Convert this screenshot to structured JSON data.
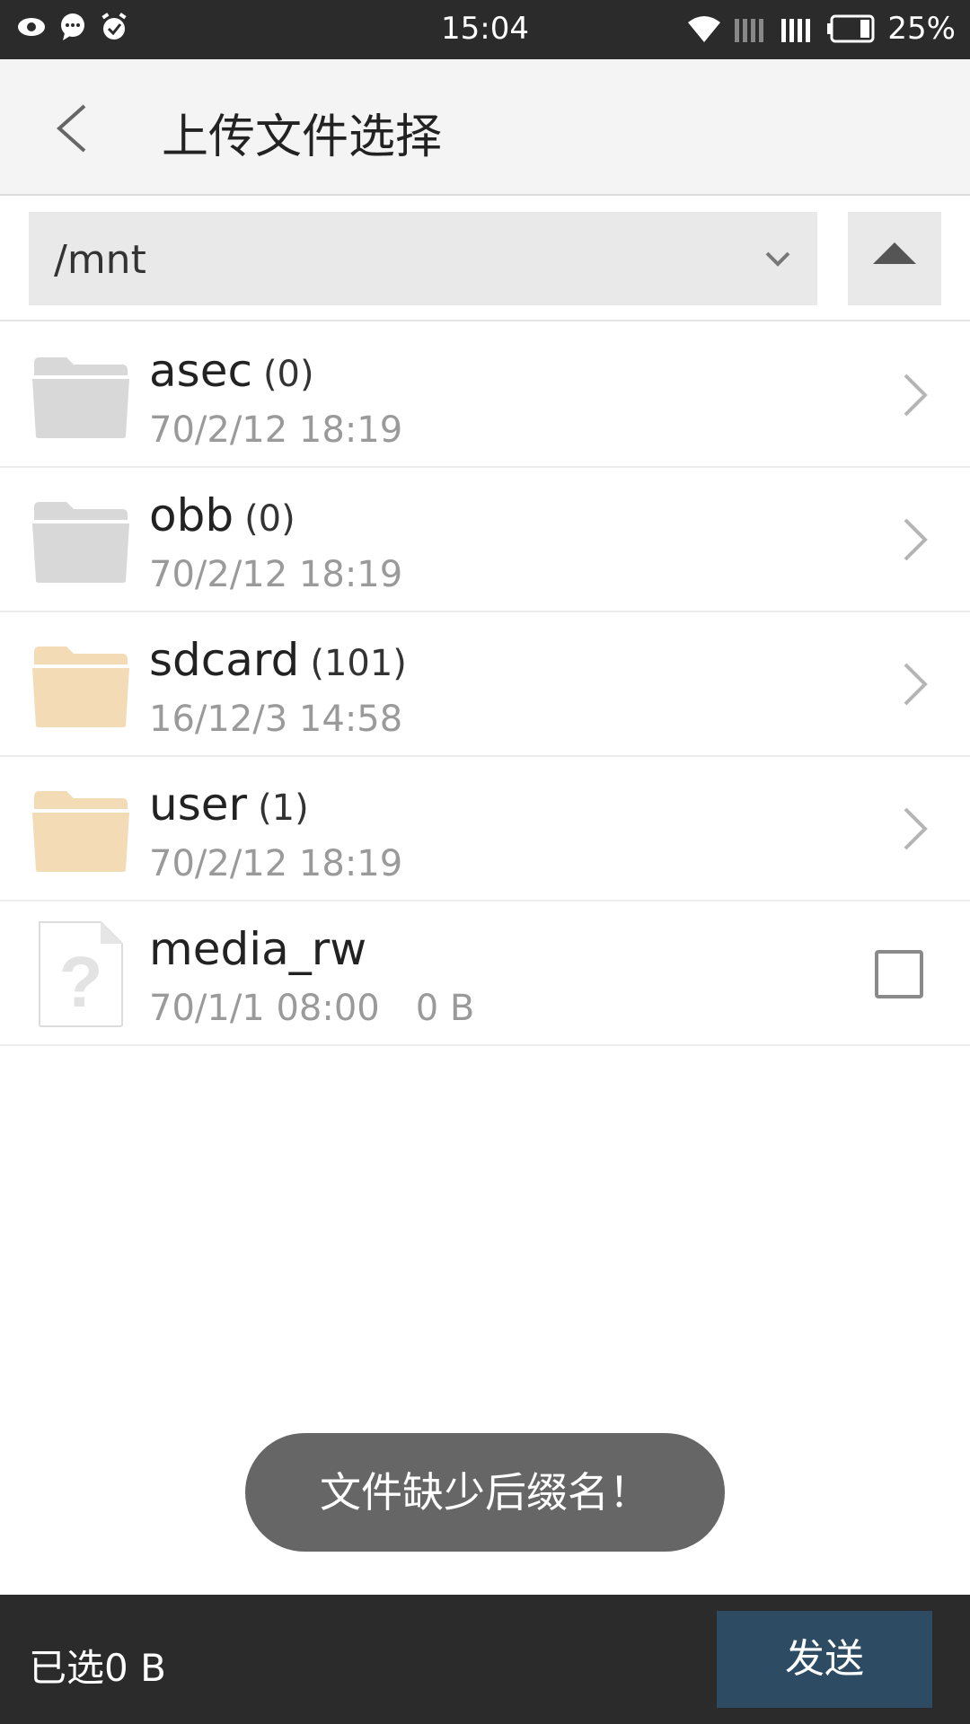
{
  "status_bar": {
    "time": "15:04",
    "battery": "25%",
    "left_icons": [
      "eye-icon",
      "chat-icon",
      "alarm-icon"
    ],
    "right_icons": [
      "wifi-icon",
      "signal-icon",
      "signal-icon",
      "battery-icon"
    ]
  },
  "app_bar": {
    "title": "上传文件选择",
    "back_icon": "back-arrow-icon"
  },
  "path_bar": {
    "current_path": "/mnt",
    "dropdown_icon": "chevron-down-icon",
    "up_icon": "triangle-up-icon"
  },
  "files": [
    {
      "name": "asec",
      "count": "(0)",
      "date": "70/2/12 18:19",
      "type": "folder",
      "color": "#d8d8d8"
    },
    {
      "name": "obb",
      "count": "(0)",
      "date": "70/2/12 18:19",
      "type": "folder",
      "color": "#d8d8d8"
    },
    {
      "name": "sdcard",
      "count": "(101)",
      "date": "16/12/3 14:58",
      "type": "folder",
      "color": "#f3dcb5"
    },
    {
      "name": "user",
      "count": "(1)",
      "date": "70/2/12 18:19",
      "type": "folder",
      "color": "#f3dcb5"
    },
    {
      "name": "media_rw",
      "date": "70/1/1 08:00",
      "size": "0 B",
      "type": "unknown-file"
    }
  ],
  "toast": {
    "message": "文件缺少后缀名！"
  },
  "bottom_bar": {
    "selected_label": "已选0 B",
    "send_label": "发送",
    "send_color": "#2d4b62"
  }
}
